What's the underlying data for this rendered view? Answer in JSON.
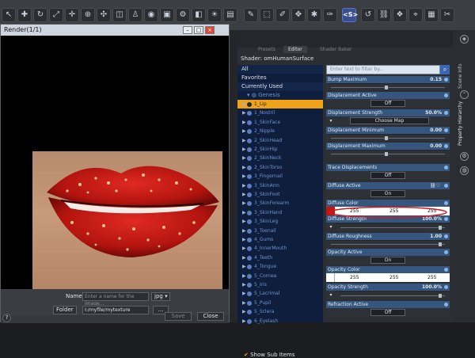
{
  "toolbar": {
    "icons": [
      "cursor-icon",
      "node-select-icon",
      "rotate-icon",
      "scale-icon",
      "translate-icon",
      "universal-icon",
      "joint-icon",
      "geometry-editor-icon",
      "active-pose-icon",
      "spot-render-icon",
      "render-icon",
      "render-settings-icon",
      "camera-icon",
      "display-icon",
      "pencil-icon",
      "surface-selection-icon",
      "edit-surface-icon",
      "node-weight-icon",
      "script-icon",
      "link-icon",
      "sds-icon",
      "reset-icon",
      "chain-icon",
      "morph-icon",
      "fit-icon",
      "frame-icon",
      "tools-icon",
      "more-icon"
    ],
    "highlight_label": "<S>"
  },
  "render_window": {
    "title": "Render(1/1)",
    "name_label": "Name",
    "name_placeholder": "Enter a name for the image...",
    "format": "jpg",
    "folder_label": "Folder",
    "folder_value": "I:/myfile/mytexture",
    "browse_label": "...",
    "save_label": "Save",
    "close_label": "Close",
    "help_label": "?"
  },
  "shader_panel": {
    "tabs": [
      "Presets",
      "Editor",
      "Shader Baker"
    ],
    "active_tab": "Editor",
    "shader_label": "Shader: omHumanSurface",
    "show_sub_items_label": "Show Sub Items",
    "categories": [
      "All",
      "Favorites",
      "Currently Used"
    ],
    "tree_root": "Genesis",
    "tree_items": [
      "1_Lip",
      "1_Nostril",
      "1_SkinFace",
      "2_Nipple",
      "2_SkinHead",
      "2_SkinHip",
      "2_SkinNeck",
      "2_SkinTorso",
      "3_Fingernail",
      "3_SkinArm",
      "3_SkinFoot",
      "3_SkinForearm",
      "3_SkinHand",
      "3_SkinLeg",
      "3_Toenail",
      "4_Gums",
      "4_InnerMouth",
      "4_Teeth",
      "4_Tongue",
      "5_Cornea",
      "5_Iris",
      "5_Lacrimal",
      "5_Pupil",
      "5_Sclera",
      "6_Eyelash"
    ],
    "selected_item": "1_Lip",
    "filter_placeholder": "Enter text to filter by...",
    "properties": {
      "bump_maximum": {
        "label": "Bump Maximum",
        "value": "0.15"
      },
      "displacement_active": {
        "label": "Displacement Active",
        "button": "Off"
      },
      "displacement_strength": {
        "label": "Displacement Strength",
        "value": "50.0%",
        "map_button": "Choose Map"
      },
      "displacement_minimum": {
        "label": "Displacement Minimum",
        "value": "0.00"
      },
      "displacement_maximum": {
        "label": "Displacement Maximum",
        "value": "0.00"
      },
      "trace_displacements": {
        "label": "Trace Displacements",
        "button": "Off"
      },
      "diffuse_active": {
        "label": "Diffuse Active",
        "button": "On"
      },
      "diffuse_color": {
        "label": "Diffuse Color",
        "r": "255",
        "g": "255",
        "b": "255",
        "swatch": "#c01616"
      },
      "diffuse_strength": {
        "label": "Diffuse Strength",
        "value": "100.0%"
      },
      "diffuse_roughness": {
        "label": "Diffuse Roughness",
        "value": "1.00"
      },
      "opacity_active": {
        "label": "Opacity Active",
        "button": "On"
      },
      "opacity_color": {
        "label": "Opacity Color",
        "r": "255",
        "g": "255",
        "b": "255"
      },
      "opacity_strength": {
        "label": "Opacity Strength",
        "value": "100.0%"
      },
      "refraction_active": {
        "label": "Refraction Active",
        "button": "Off"
      }
    }
  },
  "right_strip": {
    "tabs": [
      "Scene Info",
      "Property Hierarchy"
    ]
  },
  "colors": {
    "accent": "#f0a319",
    "panel_header": "#34567f",
    "tree_bg": "#0f1e3d",
    "lip_red": "#c01616"
  }
}
